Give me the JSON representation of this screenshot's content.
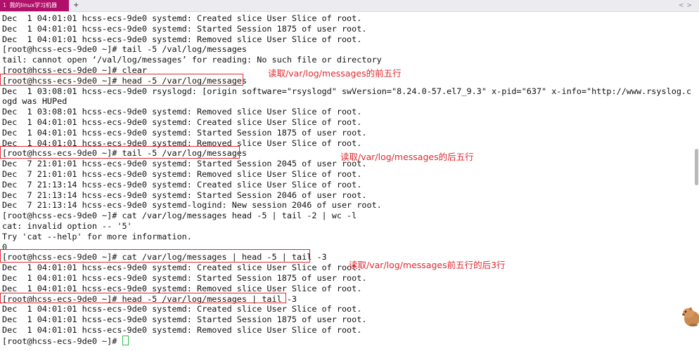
{
  "tab": {
    "number": "1",
    "title": "我的linux学习机器",
    "new_tab": "+",
    "nav_prev": "<",
    "nav_next": ">"
  },
  "terminal": {
    "lines": [
      "Dec  1 04:01:01 hcss-ecs-9de0 systemd: Created slice User Slice of root.",
      "Dec  1 04:01:01 hcss-ecs-9de0 systemd: Started Session 1875 of user root.",
      "Dec  1 04:01:01 hcss-ecs-9de0 systemd: Removed slice User Slice of root.",
      "[root@hcss-ecs-9de0 ~]# tail -5 /val/log/messages",
      "tail: cannot open ‘/val/log/messages’ for reading: No such file or directory",
      "[root@hcss-ecs-9de0 ~]# clear",
      "[root@hcss-ecs-9de0 ~]# head -5 /var/log/messages",
      "Dec  1 03:08:01 hcss-ecs-9de0 rsyslogd: [origin software=\"rsyslogd\" swVersion=\"8.24.0-57.el7_9.3\" x-pid=\"637\" x-info=\"http://www.rsyslog.com\"] rsysl",
      "ogd was HUPed",
      "Dec  1 03:08:01 hcss-ecs-9de0 systemd: Removed slice User Slice of root.",
      "Dec  1 04:01:01 hcss-ecs-9de0 systemd: Created slice User Slice of root.",
      "Dec  1 04:01:01 hcss-ecs-9de0 systemd: Started Session 1875 of user root.",
      "Dec  1 04:01:01 hcss-ecs-9de0 systemd: Removed slice User Slice of root.",
      "[root@hcss-ecs-9de0 ~]# tail -5 /var/log/messages",
      "Dec  7 21:01:01 hcss-ecs-9de0 systemd: Started Session 2045 of user root.",
      "Dec  7 21:01:01 hcss-ecs-9de0 systemd: Removed slice User Slice of root.",
      "Dec  7 21:13:14 hcss-ecs-9de0 systemd: Created slice User Slice of root.",
      "Dec  7 21:13:14 hcss-ecs-9de0 systemd: Started Session 2046 of user root.",
      "Dec  7 21:13:14 hcss-ecs-9de0 systemd-logind: New session 2046 of user root.",
      "[root@hcss-ecs-9de0 ~]# cat /var/log/messages head -5 | tail -2 | wc -l",
      "cat: invalid option -- '5'",
      "Try 'cat --help' for more information.",
      "0",
      "[root@hcss-ecs-9de0 ~]# cat /var/log/messages | head -5 | tail -3",
      "Dec  1 04:01:01 hcss-ecs-9de0 systemd: Created slice User Slice of root.",
      "Dec  1 04:01:01 hcss-ecs-9de0 systemd: Started Session 1875 of user root.",
      "Dec  1 04:01:01 hcss-ecs-9de0 systemd: Removed slice User Slice of root.",
      "[root@hcss-ecs-9de0 ~]# head -5 /var/log/messages | tail -3",
      "Dec  1 04:01:01 hcss-ecs-9de0 systemd: Created slice User Slice of root.",
      "Dec  1 04:01:01 hcss-ecs-9de0 systemd: Started Session 1875 of user root.",
      "Dec  1 04:01:01 hcss-ecs-9de0 systemd: Removed slice User Slice of root.",
      "[root@hcss-ecs-9de0 ~]# "
    ]
  },
  "annotations": {
    "head_note": "读取/var/log/messages的前五行",
    "tail_note": "读取/var/log/messages的后五行",
    "pipe_note": "读取/var/log/messages前五行的后3行"
  },
  "colors": {
    "annotation": "#e0282e",
    "tab_active": "#b0106a",
    "cursor": "#2bbd4a"
  }
}
